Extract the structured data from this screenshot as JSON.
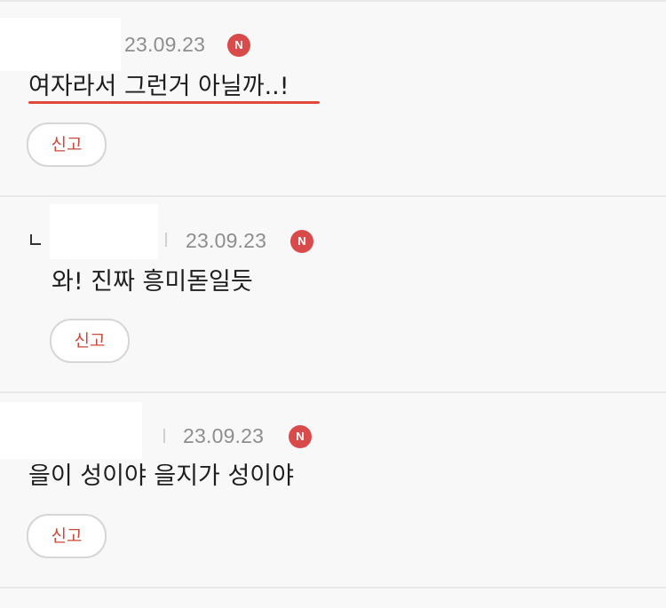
{
  "comments": [
    {
      "date": "23.09.23",
      "badge": "N",
      "text": "여자라서 그런거 아닐까..!",
      "report_label": "신고",
      "highlighted": true,
      "is_reply": false
    },
    {
      "date": "23.09.23",
      "badge": "N",
      "text": "와! 진짜 흥미돋일듯",
      "report_label": "신고",
      "highlighted": false,
      "is_reply": true
    },
    {
      "date": "23.09.23",
      "badge": "N",
      "text": "을이 성이야 을지가 성이야",
      "report_label": "신고",
      "highlighted": false,
      "is_reply": false
    }
  ],
  "colors": {
    "badge": "#d94b4b",
    "report_text": "#c84a3a",
    "underline": "#e0493a",
    "date": "#8e8e8e"
  }
}
